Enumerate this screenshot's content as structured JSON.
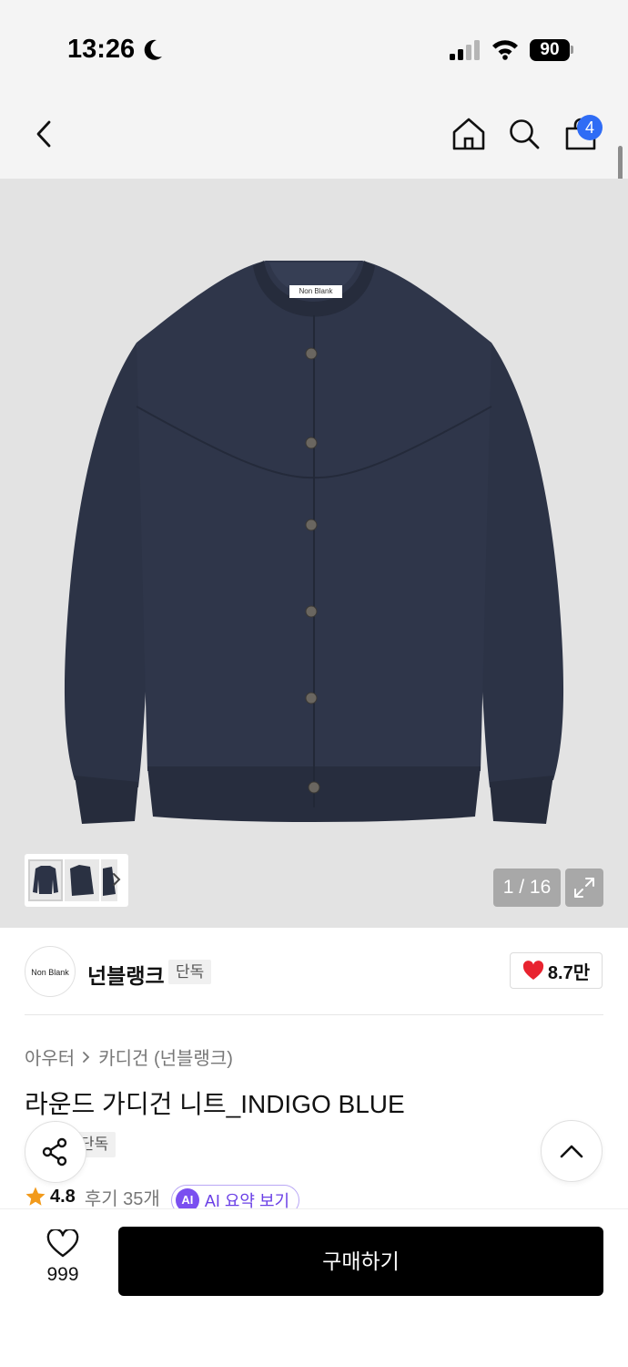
{
  "status_bar": {
    "time": "13:26",
    "battery": "90",
    "icons": [
      "moon-icon",
      "signal-icon",
      "wifi-icon",
      "battery-icon"
    ]
  },
  "nav": {
    "icons": [
      "back-arrow-icon",
      "home-icon",
      "search-icon",
      "cart-icon"
    ],
    "cart_badge": "4"
  },
  "gallery": {
    "image_label": "Non Blank",
    "page_counter": "1 / 16",
    "icons": [
      "chevron-right-icon",
      "expand-icon"
    ],
    "colors": {
      "background": "#e3e3e3",
      "garment": "#2c3346"
    }
  },
  "brand": {
    "logo_text": "Non Blank",
    "name": "넌블랭크",
    "tag": "단독",
    "likes": "8.7만",
    "icons": [
      "heart-filled-icon"
    ],
    "colors": {
      "heart": "#e8232f"
    }
  },
  "product": {
    "breadcrumb": [
      "아우터",
      "카디건 (넌블랭크)"
    ],
    "title": "라운드 가디건 니트_INDIGO BLUE",
    "exclusive_tag": "단독",
    "rating": "4.8",
    "review_count": "후기 35개",
    "ai_badge": "AI",
    "ai_summary": "AI 요약 보기",
    "icons": [
      "star-icon",
      "share-icon",
      "chevron-up-icon"
    ],
    "colors": {
      "star": "#f29a1b",
      "ai": "#7a4ff0"
    }
  },
  "bottom_bar": {
    "wishlist_count": "999",
    "buy_label": "구매하기",
    "icons": [
      "heart-outline-icon"
    ],
    "colors": {
      "buy_button": "#000000"
    }
  }
}
